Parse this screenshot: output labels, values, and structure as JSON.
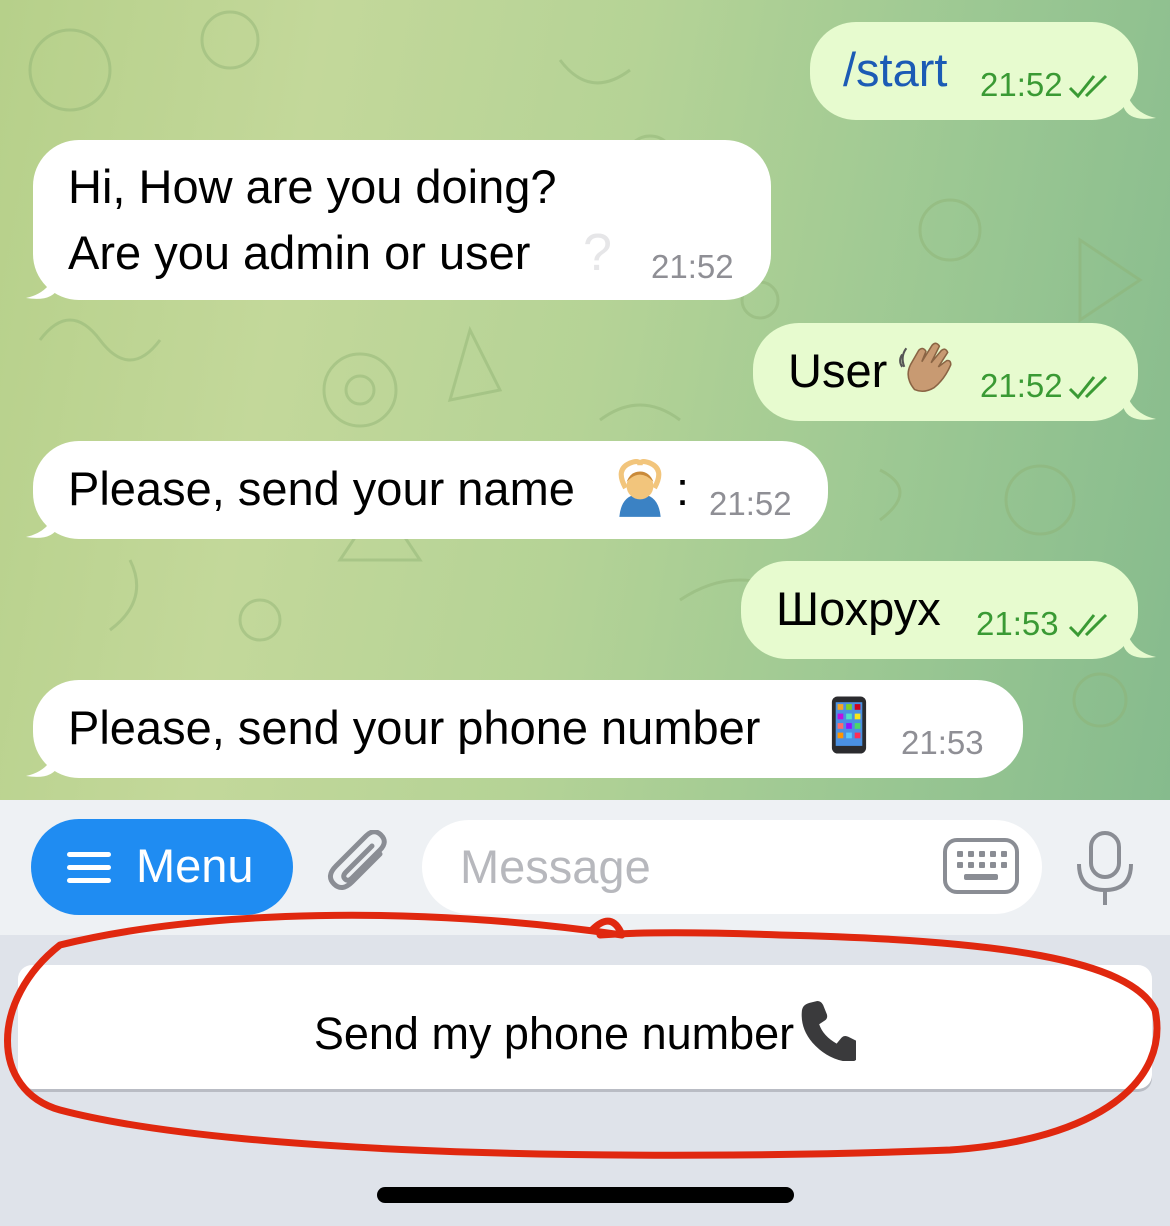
{
  "messages": [
    {
      "dir": "out",
      "parts": [
        {
          "text": "/start",
          "style": "command"
        }
      ],
      "time": "21:52",
      "read": true
    },
    {
      "dir": "in",
      "lines": [
        "Hi, How are you doing?",
        "Are you admin or user"
      ],
      "trailing_emoji": "white-question-mark",
      "time": "21:52"
    },
    {
      "dir": "out",
      "text": "User",
      "emoji": "waving-hand-medium-skin-tone",
      "time": "21:52",
      "read": true
    },
    {
      "dir": "in",
      "text": "Please, send your name",
      "emoji": "man-gesturing-ok",
      "suffix": ":",
      "time": "21:52"
    },
    {
      "dir": "out",
      "text": "Шохрух",
      "time": "21:53",
      "read": true
    },
    {
      "dir": "in",
      "text": "Please, send your phone number",
      "emoji": "mobile-phone",
      "time": "21:53"
    }
  ],
  "input_bar": {
    "menu_label": "Menu",
    "placeholder": "Message"
  },
  "reply_keyboard": {
    "buttons": [
      {
        "label": "Send my phone number",
        "emoji": "telephone-receiver"
      }
    ]
  },
  "annotation": {
    "shape": "hand-drawn red ellipse around reply keyboard button",
    "color": "#e0280f"
  },
  "colors": {
    "incoming_bubble": "#ffffff",
    "outgoing_bubble": "#e7fbcf",
    "outgoing_time": "#3a9a34",
    "menu_button": "#1f8cf2",
    "command_link": "#1c5bb5"
  }
}
